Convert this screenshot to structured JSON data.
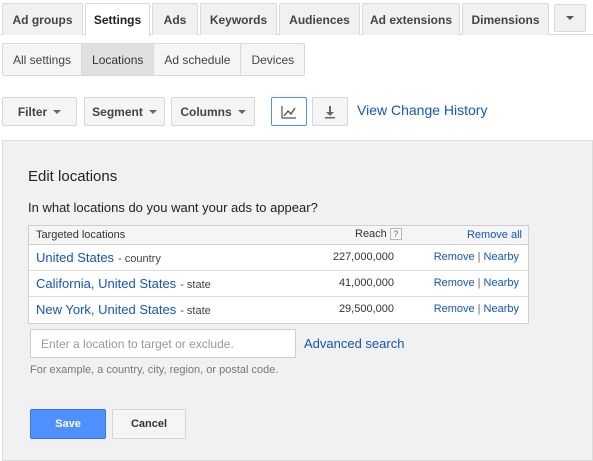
{
  "tabs": [
    {
      "label": "Ad groups",
      "active": false
    },
    {
      "label": "Settings",
      "active": true
    },
    {
      "label": "Ads",
      "active": false
    },
    {
      "label": "Keywords",
      "active": false
    },
    {
      "label": "Audiences",
      "active": false
    },
    {
      "label": "Ad extensions",
      "active": false
    },
    {
      "label": "Dimensions",
      "active": false
    }
  ],
  "subtabs": [
    {
      "label": "All settings",
      "active": false
    },
    {
      "label": "Locations",
      "active": true
    },
    {
      "label": "Ad schedule",
      "active": false
    },
    {
      "label": "Devices",
      "active": false
    }
  ],
  "toolbar": {
    "filter_label": "Filter",
    "segment_label": "Segment",
    "columns_label": "Columns",
    "chart_icon": "line-chart-icon",
    "download_icon": "download-icon",
    "view_change_history": "View Change History"
  },
  "panel": {
    "title": "Edit locations",
    "question": "In what locations do you want your ads to appear?",
    "table": {
      "header_targeted": "Targeted locations",
      "header_reach": "Reach",
      "header_help": "?",
      "remove_all": "Remove all",
      "rows": [
        {
          "name": "United States",
          "type": "- country",
          "reach": "227,000,000",
          "remove": "Remove",
          "sep": "|",
          "nearby": "Nearby"
        },
        {
          "name": "California, United States",
          "type": "- state",
          "reach": "41,000,000",
          "remove": "Remove",
          "sep": "|",
          "nearby": "Nearby"
        },
        {
          "name": "New York, United States",
          "type": "- state",
          "reach": "29,500,000",
          "remove": "Remove",
          "sep": "|",
          "nearby": "Nearby"
        }
      ]
    },
    "location_input_placeholder": "Enter a location to target or exclude.",
    "advanced_search": "Advanced search",
    "hint": "For example, a country, city, region, or postal code.",
    "save_label": "Save",
    "cancel_label": "Cancel"
  },
  "colors": {
    "link": "#1155cc",
    "primary_button": "#4d90fe",
    "panel_bg": "#f1f1f1"
  }
}
